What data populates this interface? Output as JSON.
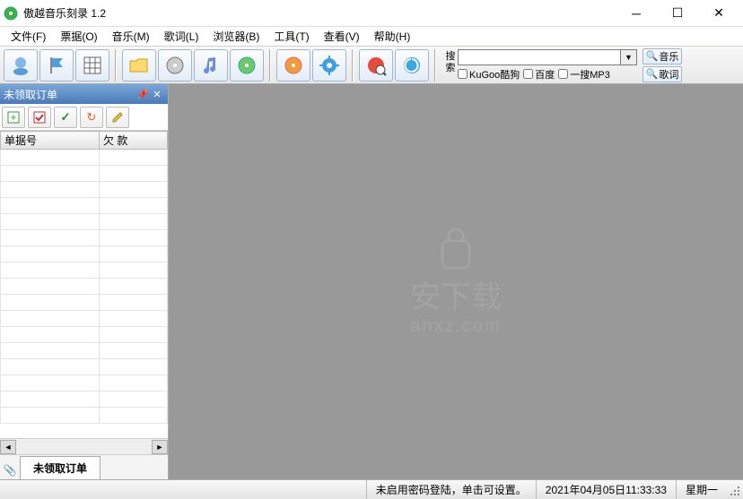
{
  "window": {
    "title": "傲越音乐刻录 1.2"
  },
  "menu": {
    "file": "文件(F)",
    "receipt": "票据(O)",
    "music": "音乐(M)",
    "lyrics": "歌词(L)",
    "browser": "浏览器(B)",
    "tools": "工具(T)",
    "view": "查看(V)",
    "help": "帮助(H)"
  },
  "toolbar_icons": {
    "msn": "msn-icon",
    "flag": "flag-icon",
    "grid": "grid-icon",
    "folder": "folder-icon",
    "disc1": "disc-icon",
    "note": "music-note-icon",
    "disc2": "disc-green-icon",
    "disc3": "disc-orange-icon",
    "gear": "gear-icon",
    "globe": "globe-icon",
    "spiral": "spiral-icon"
  },
  "search": {
    "label": "搜索",
    "value": "",
    "options": {
      "kugoo": "KuGoo酷狗",
      "baidu": "百度",
      "mp3": "一搜MP3"
    }
  },
  "right_buttons": {
    "music": "音乐",
    "lyrics": "歌词"
  },
  "sidebar": {
    "panel_title": "未领取订单",
    "columns": {
      "id": "单据号",
      "debt": "欠 款"
    },
    "tab": "未领取订单"
  },
  "watermark": {
    "main": "安下载",
    "sub": "anxz.com"
  },
  "statusbar": {
    "msg": "未启用密码登陆，单击可设置。",
    "date": "2021年04月05日11:33:33",
    "weekday": "星期一"
  }
}
